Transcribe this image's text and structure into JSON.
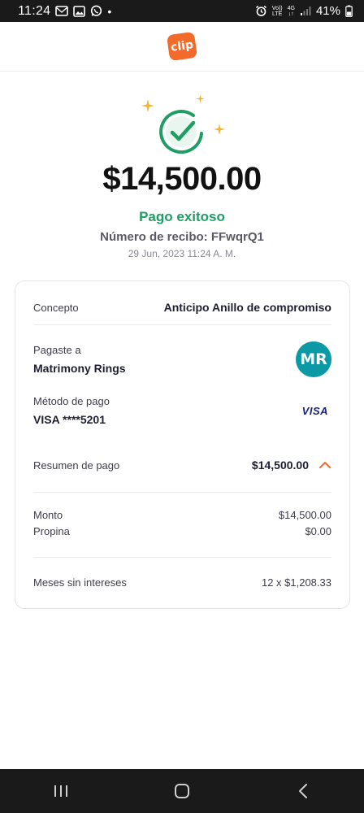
{
  "status_bar": {
    "time": "11:24",
    "dot": "•",
    "volte_top": "Vo))",
    "volte_bottom": "LTE",
    "network": "4G",
    "battery": "41%"
  },
  "header": {
    "logo_text": "clip",
    "brand_color": "#f26b2b"
  },
  "payment": {
    "amount": "$14,500.00",
    "status": "Pago exitoso",
    "receipt": "Número de recibo: FFwqrQ1",
    "datetime": "29 Jun, 2023 11:24 A. M.",
    "success_color": "#1e9e64"
  },
  "details": {
    "concept_label": "Concepto",
    "concept_value": "Anticipo Anillo de compromiso",
    "paid_to_label": "Pagaste a",
    "paid_to_value": "Matrimony Rings",
    "avatar_initials": "MR",
    "method_label": "Método de pago",
    "method_value": "VISA ****5201",
    "card_brand": "VISA",
    "summary_label": "Resumen de pago",
    "summary_value": "$14,500.00",
    "amount_label": "Monto",
    "amount_value": "$14,500.00",
    "tip_label": "Propina",
    "tip_value": "$0.00",
    "installments_label": "Meses sin intereses",
    "installments_value": "12 x $1,208.33"
  }
}
